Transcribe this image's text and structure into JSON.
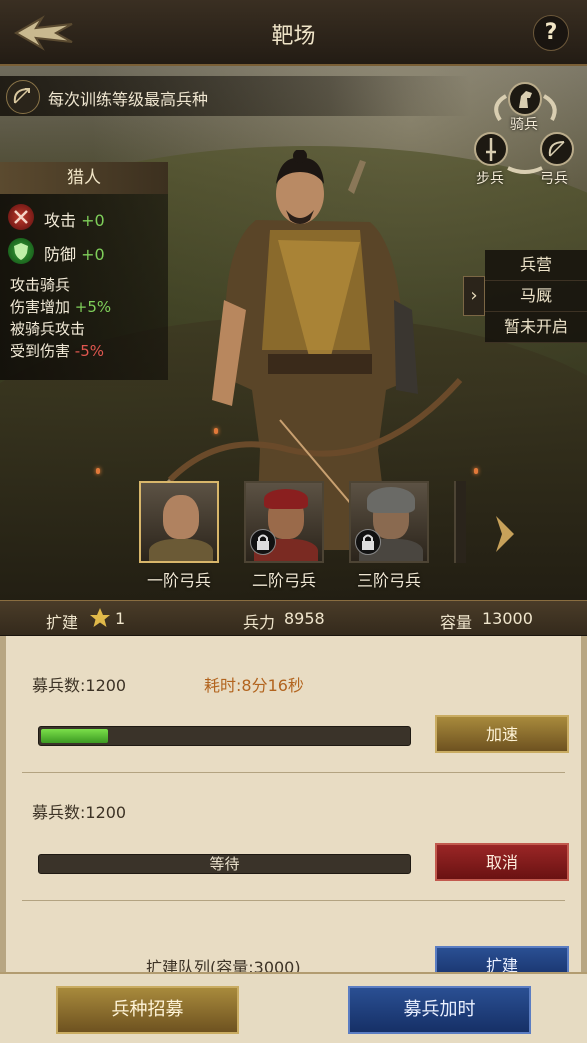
{
  "header": {
    "title": "靶场",
    "help": "?"
  },
  "objective": {
    "text": "每次训练等级最高兵种"
  },
  "cycle": {
    "cavalry": "骑兵",
    "infantry": "步兵",
    "archer": "弓兵"
  },
  "unit": {
    "name": "猎人",
    "attack_label": "攻击",
    "attack_value": "+0",
    "defense_label": "防御",
    "defense_value": "+0",
    "bonus1_a": "攻击骑兵",
    "bonus1_b_label": "伤害增加",
    "bonus1_b_value": "+5%",
    "bonus2_a": "被骑兵攻击",
    "bonus2_b_label": "受到伤害",
    "bonus2_b_value": "-5%"
  },
  "side_menu": {
    "items": [
      "兵营",
      "马厩",
      "暂未开启"
    ]
  },
  "portraits": [
    {
      "label": "一阶弓兵",
      "locked": false
    },
    {
      "label": "二阶弓兵",
      "locked": true
    },
    {
      "label": "三阶弓兵",
      "locked": true
    }
  ],
  "info_bar": {
    "expand_label": "扩建",
    "expand_level": "1",
    "power_label": "兵力",
    "power_value": "8958",
    "capacity_label": "容量",
    "capacity_value": "13000"
  },
  "queue": [
    {
      "recruit": "募兵数:1200",
      "time": "耗时:8分16秒",
      "progress": 0.18,
      "button": "加速"
    },
    {
      "recruit": "募兵数:1200",
      "status": "等待",
      "button": "取消"
    },
    {
      "partial_text": "扩建队列(容量:3000)",
      "button": "扩建"
    }
  ],
  "bottom": {
    "left_button": "兵种招募",
    "right_button": "募兵加时"
  },
  "colors": {
    "gold": "#a88a3c",
    "red": "#8a1c1c",
    "blue": "#1f3f80",
    "green_bonus": "#7fcf5a",
    "red_bonus": "#e0574f"
  }
}
